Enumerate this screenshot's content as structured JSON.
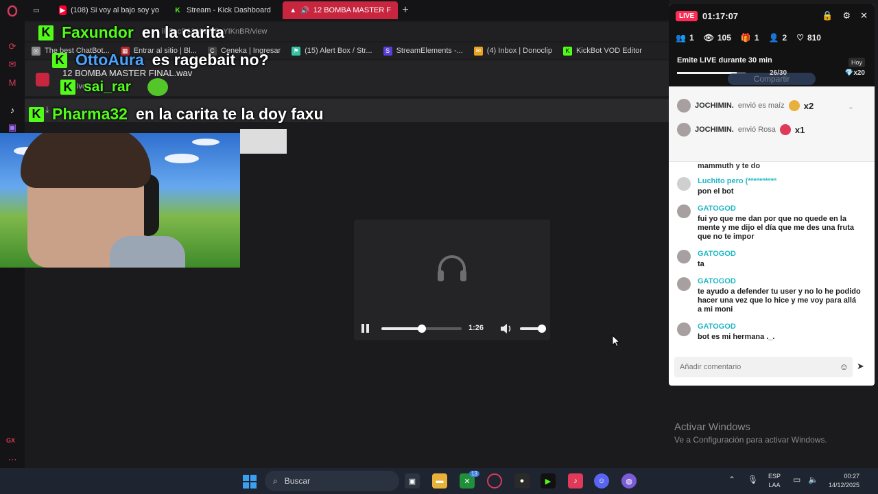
{
  "browser": {
    "tabs": [
      {
        "label": "(108) Si voy al bajo soy yo",
        "icon": "youtube-icon",
        "color": "#ff0033"
      },
      {
        "label": "Stream - Kick Dashboard",
        "icon": "kick-icon",
        "color": "#53fc18"
      },
      {
        "label": "12 BOMBA MASTER F",
        "icon": "drive-icon",
        "color": "#ffffff",
        "active": true
      }
    ],
    "url": "iPFncR6319W65_YIKnBR/view",
    "bookmarks": [
      {
        "label": "The best ChatBot...",
        "color": "#8a8a8a"
      },
      {
        "label": "Entrar al sitio | Bl...",
        "color": "#b5272d"
      },
      {
        "label": "Ceneka | Ingresar",
        "color": "#444444"
      },
      {
        "label": "(15) Alert Box / Str...",
        "color": "#33c3a0"
      },
      {
        "label": "StreamElements -...",
        "color": "#5a3fd6"
      },
      {
        "label": "(4) Inbox | Donoclip",
        "color": "#e8a21e"
      },
      {
        "label": "KickBot VOD Editor",
        "color": "#53fc18"
      }
    ],
    "file_title": "12 BOMBA MASTER FINAL.wav",
    "file_sub": "ivo"
  },
  "overlay_chat": [
    {
      "user": "Faxundor",
      "text": "en la carita",
      "user_color": "#53fc18"
    },
    {
      "user": "OttoAura",
      "text": "es ragebait no?",
      "user_color": "#4aa3ff"
    },
    {
      "user": "sai_rar",
      "text": "",
      "user_color": "#53fc18"
    },
    {
      "user": "Pharma32",
      "text": "en la carita te la doy faxu",
      "user_color": "#53fc18"
    }
  ],
  "player": {
    "time": "1:26",
    "progress": 0.5,
    "volume": 0.9
  },
  "live_panel": {
    "badge": "LIVE",
    "duration": "01:17:07",
    "stats": [
      {
        "icon": "user-icon",
        "value": "1"
      },
      {
        "icon": "eye-icon",
        "value": "105"
      },
      {
        "icon": "gift-icon",
        "value": "1"
      },
      {
        "icon": "add-user-icon",
        "value": "2"
      },
      {
        "icon": "heart-icon",
        "value": "810"
      }
    ],
    "goal": "Emite LIVE durante 30 min",
    "goal_count": "26/30",
    "goal_progress": 0.8667,
    "hoy": "Hoy",
    "x20": "x20",
    "share": "Compartir",
    "gifts": [
      {
        "user": "JOCHIMIN.",
        "action": "envió es maíz",
        "count": "x2",
        "color": "#e8b03c"
      },
      {
        "user": "JOCHIMIN.",
        "action": "envió Rosa",
        "count": "x1",
        "color": "#e03a5a"
      }
    ],
    "chat_cut": "mammuth y te do",
    "chat": [
      {
        "user": "Luchito pero (*ª*ª*ª*ª*ª",
        "text": "pon el bot"
      },
      {
        "user": "GATOGOD",
        "text": "fui yo que me dan por que no quede en la mente y me dijo el día que me des una fruta que no te impor"
      },
      {
        "user": "GATOGOD",
        "text": "ta"
      },
      {
        "user": "GATOGOD",
        "text": "te ayudo a defender tu user y no lo he podido hacer una vez que lo hice y me voy para allá a mi moni"
      },
      {
        "user": "GATOGOD",
        "text": "bot es mi hermana ._."
      }
    ],
    "input_placeholder": "Añadir comentario"
  },
  "windows": {
    "activate_title": "Activar Windows",
    "activate_sub": "Ve a Configuración para activar Windows.",
    "search": "Buscar",
    "lang_1": "ESP",
    "lang_2": "LAA",
    "time": "00:27",
    "date": "14/12/2025",
    "badge_count": "13"
  }
}
